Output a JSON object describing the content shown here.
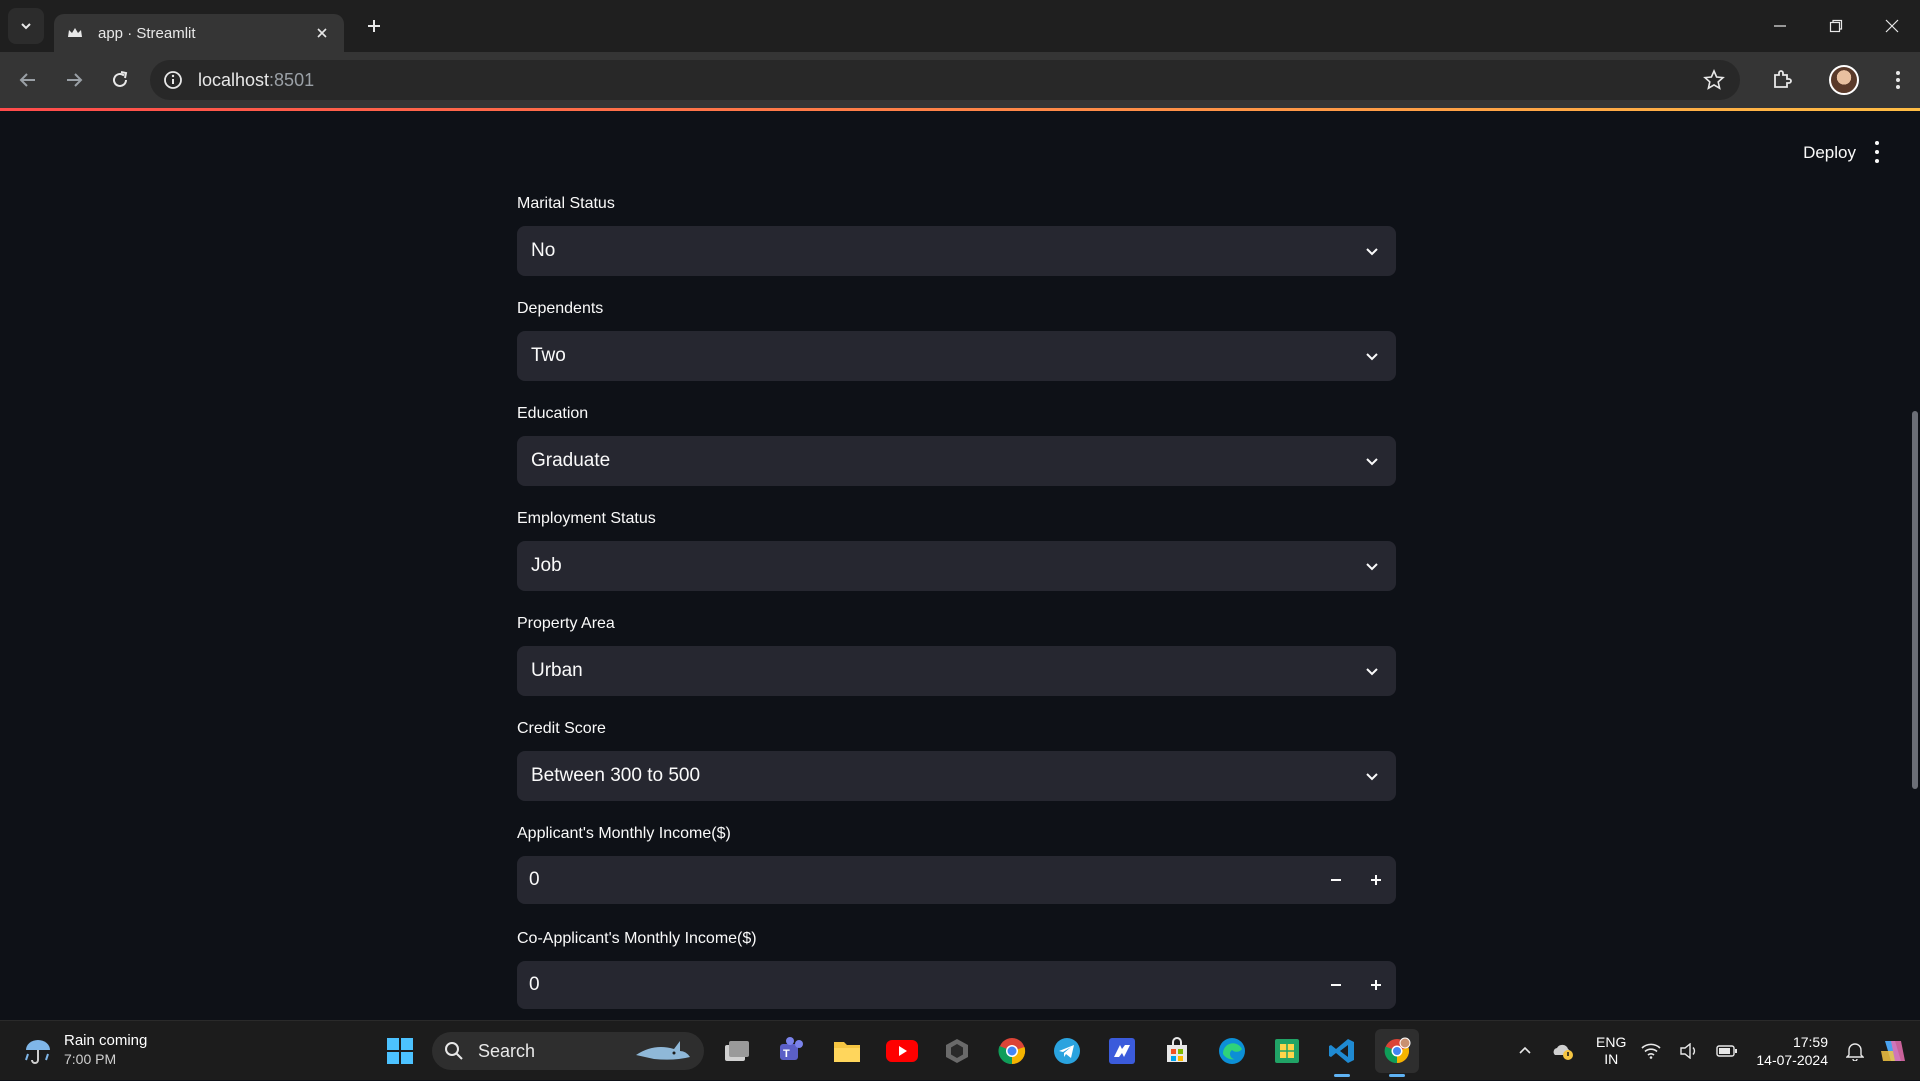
{
  "browser": {
    "tab_title": "app · Streamlit",
    "url_host": "localhost",
    "url_port": ":8501"
  },
  "header": {
    "deploy_label": "Deploy"
  },
  "form": {
    "marital_status": {
      "label": "Marital Status",
      "value": "No"
    },
    "dependents": {
      "label": "Dependents",
      "value": "Two"
    },
    "education": {
      "label": "Education",
      "value": "Graduate"
    },
    "employment_status": {
      "label": "Employment Status",
      "value": "Job"
    },
    "property_area": {
      "label": "Property Area",
      "value": "Urban"
    },
    "credit_score": {
      "label": "Credit Score",
      "value": "Between 300 to 500"
    },
    "applicant_income": {
      "label": "Applicant's Monthly Income($)",
      "value": "0"
    },
    "coapplicant_income": {
      "label": "Co-Applicant's Monthly Income($)",
      "value": "0"
    }
  },
  "taskbar": {
    "weather_title": "Rain coming",
    "weather_time": "7:00 PM",
    "search_placeholder": "Search",
    "lang_1": "ENG",
    "lang_2": "IN",
    "time": "17:59",
    "date": "14-07-2024"
  },
  "colors": {
    "app_bg": "#0e1117",
    "widget_bg": "#262730",
    "accent_start": "#ff4b4b",
    "accent_end": "#ffbd45"
  }
}
